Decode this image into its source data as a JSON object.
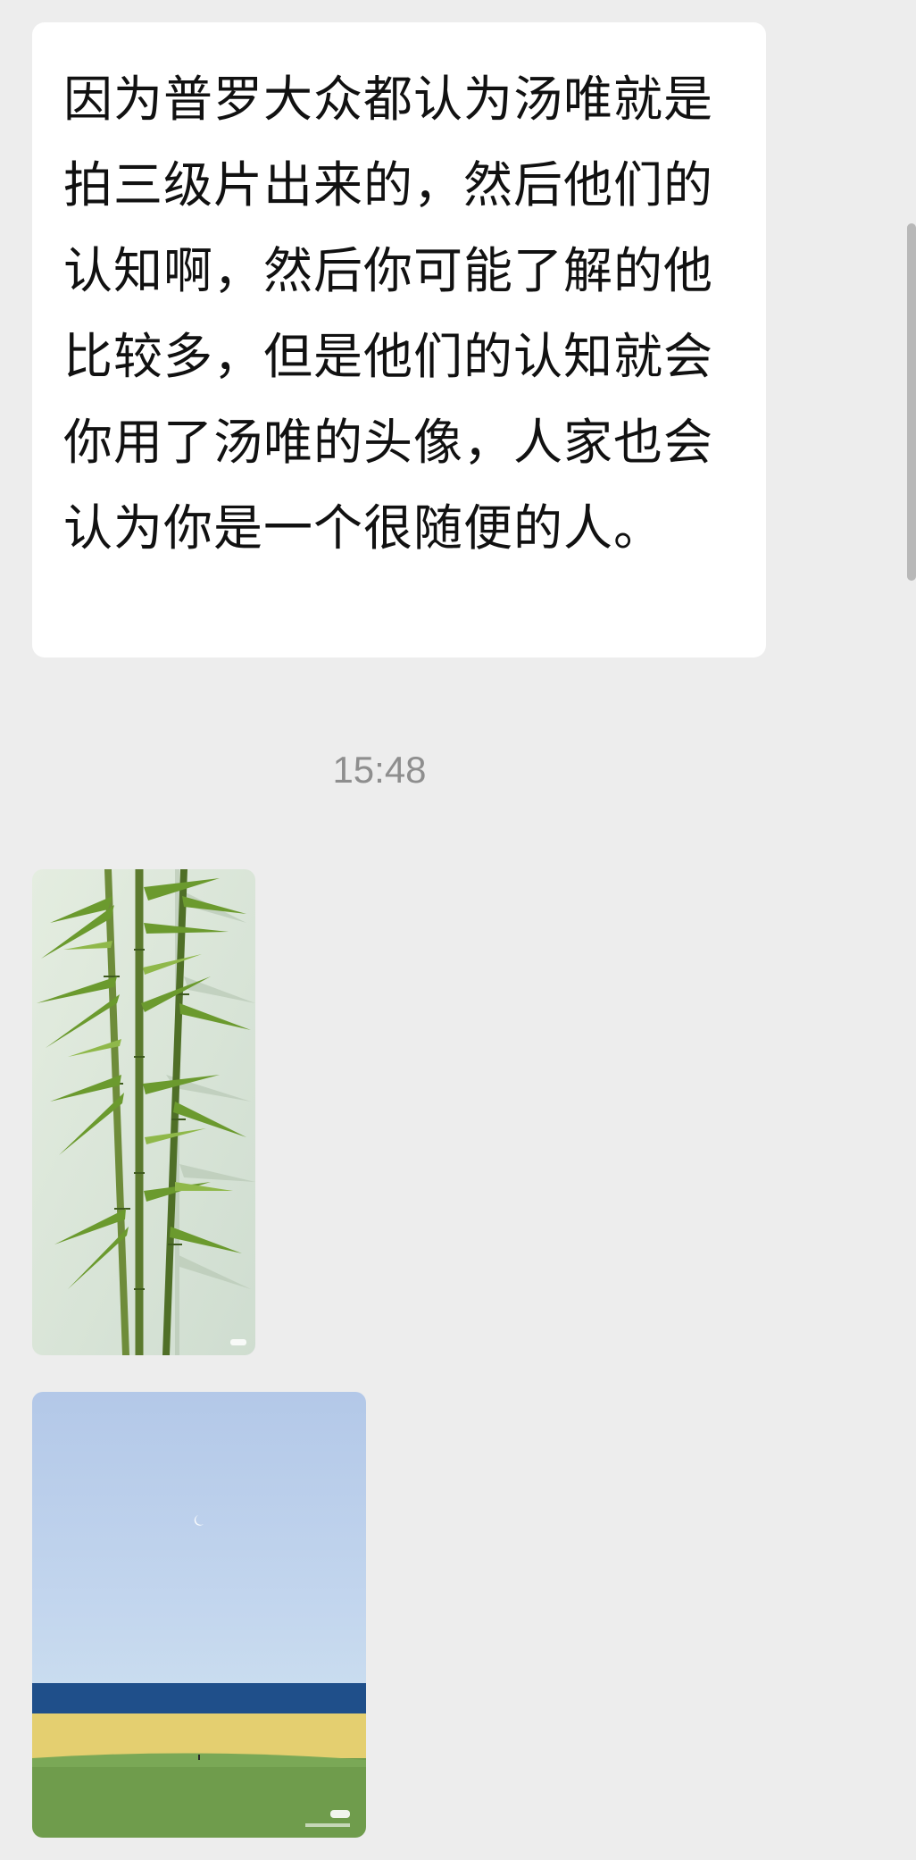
{
  "message": {
    "text": "因为普罗大众都认为汤唯就是拍三级片出来的，然后他们的认知啊，然后你可能了解的他比较多，但是他们的认知就会你用了汤唯的头像，人家也会认为你是一个很随便的人。"
  },
  "timestamp": "15:48",
  "images": [
    {
      "name": "bamboo-photo",
      "watermark": ""
    },
    {
      "name": "sea-field-photo",
      "watermark_badge": "",
      "watermark_credit": ""
    }
  ],
  "colors": {
    "background": "#ededed",
    "bubble": "#ffffff",
    "text": "#111111",
    "timestamp": "#8e8e8e"
  }
}
